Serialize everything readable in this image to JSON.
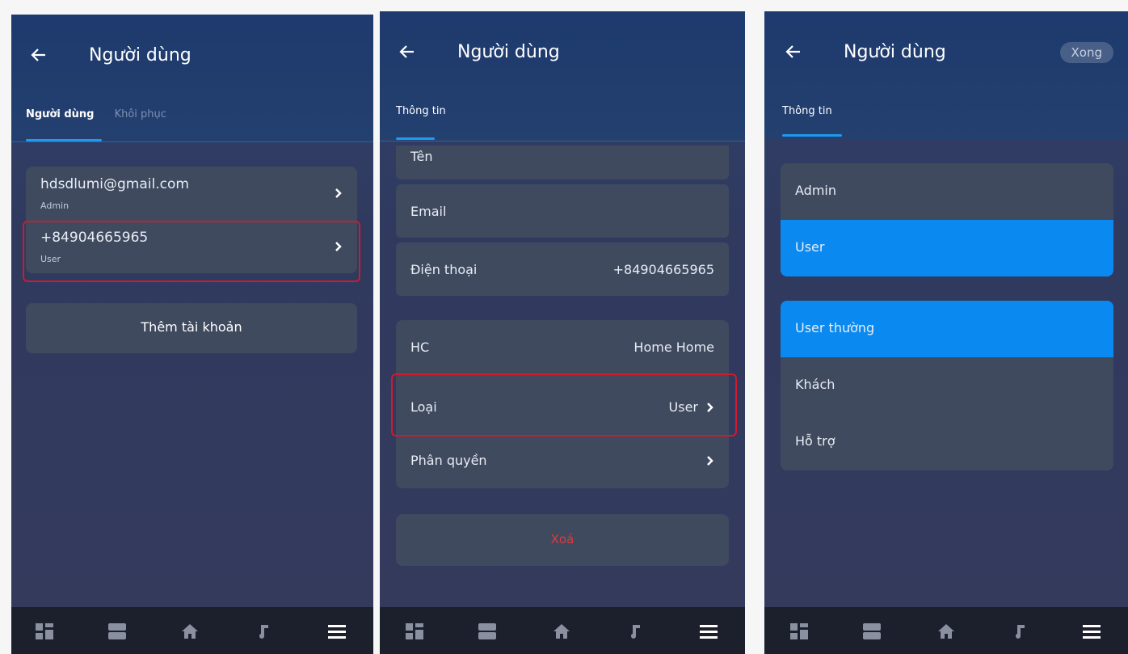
{
  "screen1": {
    "title": "Người dùng",
    "tabs": [
      {
        "label": "Người dùng",
        "active": true
      },
      {
        "label": "Khôi phục",
        "active": false
      }
    ],
    "accounts": [
      {
        "email": "hdsdlumi@gmail.com",
        "role": "Admin"
      },
      {
        "email": "+84904665965",
        "role": "User"
      }
    ],
    "add_button": "Thêm tài khoản"
  },
  "screen2": {
    "title": "Người dùng",
    "tab": "Thông tin",
    "fields": {
      "name_label": "Tên",
      "email_label": "Email",
      "phone_label": "Điện thoại",
      "phone_value": "+84904665965",
      "hc_label": "HC",
      "hc_value": "Home Home",
      "type_label": "Loại",
      "type_value": "User",
      "perm_label": "Phân quyền"
    },
    "delete_button": "Xoá"
  },
  "screen3": {
    "title": "Người dùng",
    "done_button": "Xong",
    "tab": "Thông tin",
    "group1": [
      "Admin",
      "User"
    ],
    "group1_selected": "User",
    "group2": [
      "User thường",
      "Khách",
      "Hỗ trợ"
    ],
    "group2_selected": "User thường"
  },
  "nav_icons": [
    "dashboard-icon",
    "rooms-icon",
    "home-icon",
    "music-icon",
    "menu-icon"
  ],
  "colors": {
    "accent": "#0a8af0",
    "highlight": "#d11a2a",
    "danger": "#e03a3a"
  }
}
